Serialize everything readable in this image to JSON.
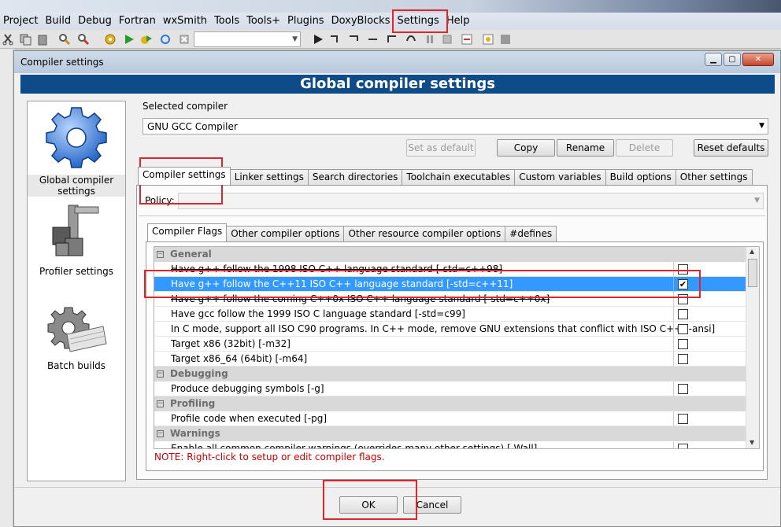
{
  "ide": {
    "menus": [
      "Project",
      "Build",
      "Debug",
      "Fortran",
      "wxSmith",
      "Tools",
      "Tools+",
      "Plugins",
      "DoxyBlocks",
      "Settings",
      "Help"
    ]
  },
  "dialog": {
    "window_title": "Compiler settings",
    "header": "Global compiler settings",
    "nav": [
      {
        "label_l1": "Global compiler",
        "label_l2": "settings",
        "icon": "gear-icon"
      },
      {
        "label_l1": "Profiler settings",
        "label_l2": "",
        "icon": "caliper-icon"
      },
      {
        "label_l1": "Batch builds",
        "label_l2": "",
        "icon": "gear-stack-icon"
      }
    ],
    "selected_compiler_label": "Selected compiler",
    "selected_compiler_value": "GNU GCC Compiler",
    "buttons": {
      "set_default": "Set as default",
      "copy": "Copy",
      "rename": "Rename",
      "delete": "Delete",
      "reset_defaults": "Reset defaults",
      "ok": "OK",
      "cancel": "Cancel"
    },
    "main_tabs": [
      "Compiler settings",
      "Linker settings",
      "Search directories",
      "Toolchain executables",
      "Custom variables",
      "Build options",
      "Other settings"
    ],
    "policy_label": "Policy:",
    "sub_tabs": [
      "Compiler Flags",
      "Other compiler options",
      "Other resource compiler options",
      "#defines"
    ],
    "flags": [
      {
        "type": "category",
        "text": "General"
      },
      {
        "type": "flag",
        "text": "Have g++ follow the 1998 ISO C++ language standard  [-std=c++98]",
        "checked": false,
        "strike": true
      },
      {
        "type": "flag",
        "text": "Have g++ follow the C++11 ISO C++ language standard  [-std=c++11]",
        "checked": true,
        "selected": true
      },
      {
        "type": "flag",
        "text": "Have g++ follow the coming C++0x ISO C++ language standard  [-std=c++0x]",
        "checked": false,
        "strike": true
      },
      {
        "type": "flag",
        "text": "Have gcc follow the 1999 ISO C language standard  [-std=c99]",
        "checked": false
      },
      {
        "type": "flag",
        "text": "In C mode, support all ISO C90 programs. In C++ mode, remove GNU extensions that conflict with ISO C++  [-ansi]",
        "checked": false
      },
      {
        "type": "flag",
        "text": "Target x86 (32bit)  [-m32]",
        "checked": false
      },
      {
        "type": "flag",
        "text": "Target x86_64 (64bit)  [-m64]",
        "checked": false
      },
      {
        "type": "category",
        "text": "Debugging"
      },
      {
        "type": "flag",
        "text": "Produce debugging symbols  [-g]",
        "checked": false
      },
      {
        "type": "category",
        "text": "Profiling"
      },
      {
        "type": "flag",
        "text": "Profile code when executed  [-pg]",
        "checked": false
      },
      {
        "type": "category",
        "text": "Warnings"
      },
      {
        "type": "flag",
        "text": "Enable all common compiler warnings (overrides many other settings)  [-Wall]",
        "checked": false
      }
    ],
    "note": "NOTE: Right-click to setup or edit compiler flags."
  }
}
